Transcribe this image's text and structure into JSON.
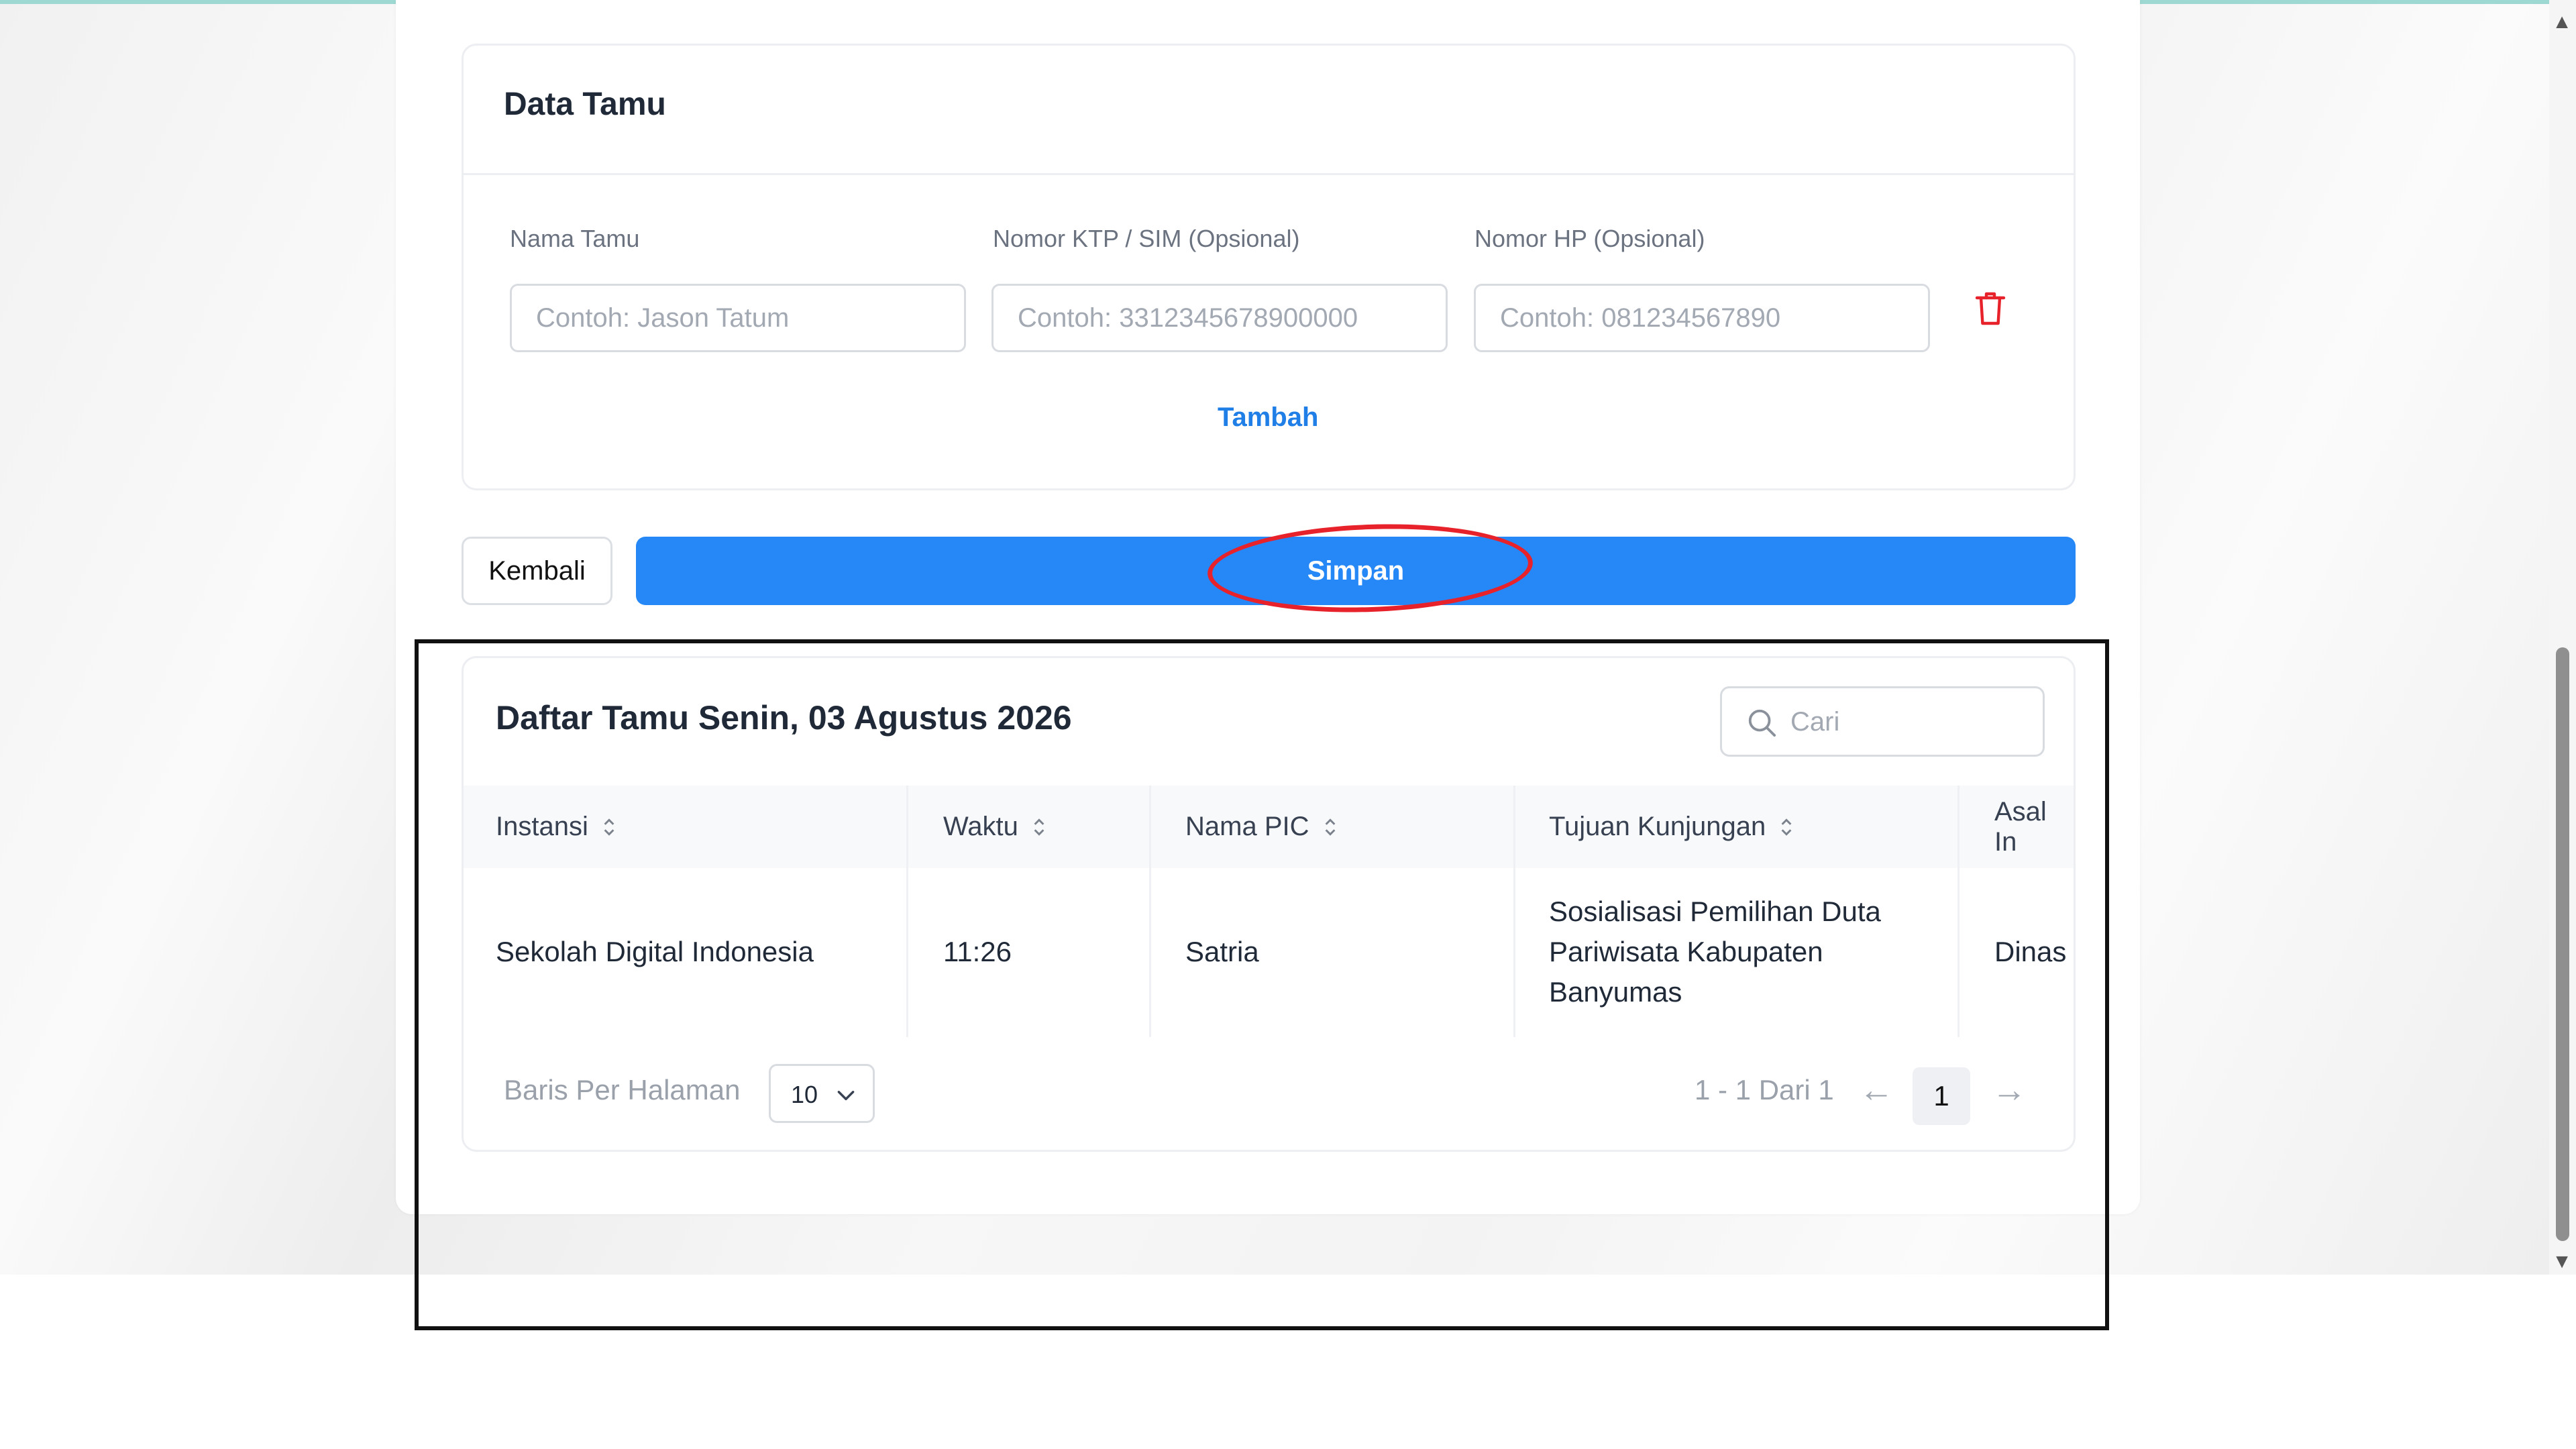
{
  "guest_form": {
    "title": "Data Tamu",
    "fields": [
      {
        "label": "Nama Tamu",
        "placeholder": "Contoh: Jason Tatum",
        "value": ""
      },
      {
        "label": "Nomor KTP / SIM (Opsional)",
        "placeholder": "Contoh: 3312345678900000",
        "value": ""
      },
      {
        "label": "Nomor HP (Opsional)",
        "placeholder": "Contoh: 081234567890",
        "value": ""
      }
    ],
    "add_label": "Tambah",
    "delete_icon": "trash-icon"
  },
  "actions": {
    "back_label": "Kembali",
    "save_label": "Simpan"
  },
  "guest_list": {
    "title": "Daftar Tamu Senin, 03 Agustus 2026",
    "search_placeholder": "Cari",
    "columns": [
      "Instansi",
      "Waktu",
      "Nama PIC",
      "Tujuan Kunjungan",
      "Asal In"
    ],
    "rows": [
      {
        "instansi": "Sekolah Digital Indonesia",
        "waktu": "11:26",
        "nama_pic": "Satria",
        "tujuan_lines": [
          "Sosialisasi Pemilihan Duta",
          "Pariwisata Kabupaten",
          "Banyumas"
        ],
        "asal": "Dinas"
      }
    ],
    "pagination": {
      "rows_per_page_label": "Baris Per Halaman",
      "rows_per_page": "10",
      "range_text": "1 - 1 Dari 1",
      "current_page": "1",
      "prev_symbol": "←",
      "next_symbol": "→"
    }
  },
  "colors": {
    "primary": "#2688f7",
    "link": "#1f7fe6",
    "danger": "#e8222b",
    "annotation_ellipse": "#e8222b",
    "annotation_box": "#111111"
  }
}
